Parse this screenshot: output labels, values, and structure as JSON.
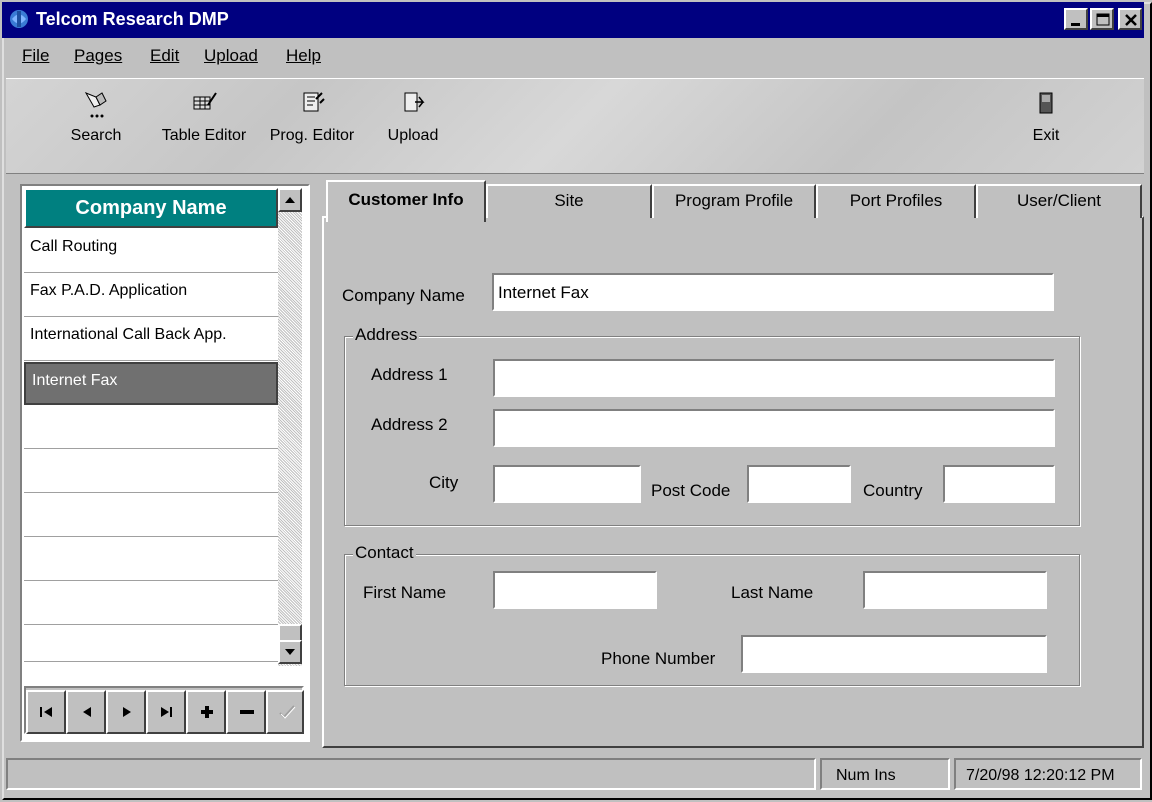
{
  "window": {
    "title": "Telcom Research DMP"
  },
  "menu": [
    "File",
    "Pages",
    "Edit",
    "Upload",
    "Help"
  ],
  "toolbar": {
    "search": "Search",
    "table_editor": "Table Editor",
    "prog_editor": "Prog. Editor",
    "upload": "Upload",
    "exit": "Exit"
  },
  "company_list": {
    "header": "Company Name",
    "items": [
      "Call Routing",
      "Fax P.A.D. Application",
      "International Call Back App.",
      "Internet Fax"
    ],
    "selected": "Internet Fax"
  },
  "tabs": [
    "Customer Info",
    "Site",
    "Program Profile",
    "Port Profiles",
    "User/Client"
  ],
  "active_tab": "Customer Info",
  "form": {
    "company_name_label": "Company Name",
    "company_name_value": "Internet Fax",
    "address_group": "Address",
    "address1_label": "Address 1",
    "address1_value": "",
    "address2_label": "Address 2",
    "address2_value": "",
    "city_label": "City",
    "city_value": "",
    "postcode_label": "Post Code",
    "postcode_value": "",
    "country_label": "Country",
    "country_value": "",
    "contact_group": "Contact",
    "first_name_label": "First Name",
    "first_name_value": "",
    "last_name_label": "Last Name",
    "last_name_value": "",
    "phone_label": "Phone Number",
    "phone_value": ""
  },
  "status": {
    "message": "",
    "keys": "Num  Ins",
    "datetime": "7/20/98 12:20:12 PM"
  },
  "colors": {
    "title_bar": "#000080",
    "list_header": "#008080",
    "selected_row": "#707070"
  }
}
